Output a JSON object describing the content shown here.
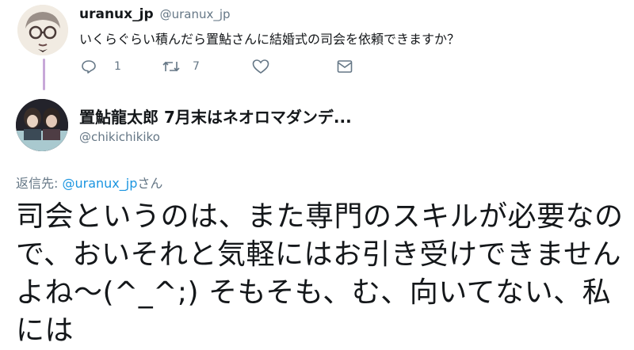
{
  "tweet1": {
    "display_name": "uranux_jp",
    "handle": "@uranux_jp",
    "text": "いくらぐらい積んだら置鮎さんに結婚式の司会を依頼できますか？",
    "reply_count": "1",
    "retweet_count": "7",
    "icons": [
      "reply-icon",
      "retweet-icon",
      "like-icon",
      "dm-icon"
    ]
  },
  "tweet2": {
    "display_name": "置鮎龍太郎 7月末はネオロマダンデ...",
    "handle": "@chikichikiko",
    "reply_label": "返信先:",
    "reply_target": "@uranux_jp",
    "reply_suffix": "さん",
    "text": "司会というのは、また専門のスキルが必要なので、おいそれと気軽にはお引き受けできませんよね〜(^_^;) そもそも、む、向いてない、私には"
  },
  "colors": {
    "link": "#1b95e0",
    "secondary": "#657786",
    "thread_line": "#c8a8d8"
  }
}
